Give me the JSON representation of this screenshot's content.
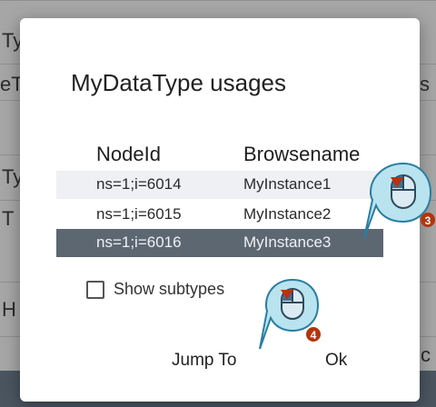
{
  "background": {
    "fragments": [
      "Ty",
      "eT",
      "s",
      "Ty",
      "T",
      "H",
      "c"
    ]
  },
  "dialog": {
    "title": "MyDataType usages",
    "columns": [
      "NodeId",
      "Browsename"
    ],
    "rows": [
      {
        "nodeid": "ns=1;i=6014",
        "browsename": "MyInstance1",
        "state": "hovered"
      },
      {
        "nodeid": "ns=1;i=6015",
        "browsename": "MyInstance2",
        "state": "normal"
      },
      {
        "nodeid": "ns=1;i=6016",
        "browsename": "MyInstance3",
        "state": "selected"
      }
    ],
    "show_subtypes": {
      "label": "Show subtypes",
      "checked": false
    },
    "buttons": {
      "jump_to": "Jump To",
      "ok": "Ok"
    }
  },
  "markers": [
    {
      "step": "3",
      "icon": "mouse-click-icon"
    },
    {
      "step": "4",
      "icon": "mouse-click-icon"
    }
  ],
  "colors": {
    "selected_row": "#5c6772",
    "hover_row": "#eef0f3",
    "marker_fill": "#b9e3ef",
    "marker_stroke": "#2a7ea3",
    "badge": "#b5340e"
  }
}
